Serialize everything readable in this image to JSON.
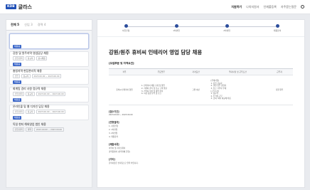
{
  "app": {
    "logo_mark": "KDB",
    "name": "글라스"
  },
  "topnav": {
    "items": [
      {
        "label": "지원하기",
        "active": true
      },
      {
        "label": "나의지원서",
        "active": false
      },
      {
        "label": "인재풀등록",
        "active": false
      },
      {
        "label": "자주묻는질문",
        "active": false
      }
    ]
  },
  "sidebar": {
    "tabs": [
      {
        "label": "전체 5",
        "active": true
      },
      {
        "label": "신입 3",
        "active": false
      },
      {
        "label": "경력 4",
        "active": false
      }
    ],
    "jobs": [
      {
        "badge": "채용중",
        "title": "강원 및 원주지역 영업담당 채용",
        "chips": [
          "신입/경력",
          "정규직",
          "상시채용"
        ]
      },
      {
        "badge": "채용중",
        "title": "충청지역 현장관리직 채용",
        "chips": [
          "신입",
          "정규직",
          "2023.00.00 ~ 2023.00.00"
        ]
      },
      {
        "badge": "채용중",
        "title": "회계팀 경리 사원 정규직 채용",
        "chips": [
          "신입/경력",
          "정규직",
          "2023.00.00 ~ 2023.00.00"
        ]
      },
      {
        "badge": "채용중",
        "title": "온라인몰 및 웹 디자인 담당 채용",
        "chips": [
          "신입/경력",
          "정규직",
          "2023.00.00 ~ 2023.00.00"
        ]
      },
      {
        "badge": "채용중",
        "title": "독일 현지 해외영업 법인 채용",
        "chips": [
          "신입/경력",
          "계약",
          "2023.00.00 ~ 2023.00.00"
        ]
      }
    ]
  },
  "stepper": {
    "steps": [
      "서류전형",
      "1차면접",
      "2차면접",
      "최종합격"
    ]
  },
  "main": {
    "title": "강원/원주 휴비씨 인테리어 영업 담당 채용",
    "section": "[모집부문 및 자격요건]",
    "table": {
      "headers": [
        "직무",
        "주요업무",
        "자격요건",
        "우대사항 및 근무조건",
        "근무지"
      ],
      "row": {
        "c1": "휴비씨 인테리어 영업",
        "c2": "1. 인테리어 제품 소개 및 영업\n2. 거래처 관리 및 신규 고객 발굴\n3. 견적서 작성 및 계약 관리\n4. 시장 동향 분석 및 보고",
        "c3": "고졸 이상",
        "c4": "[우대사항]\n1. 운전 가능자\n2. 관련 업무 경험자\n3. 인근 거주자 우대\n[근무조건]\n1. 정규직\n2. 주 5일 근무\n3. 급여: 회사 내규에 따름",
        "c5": "강원 원주"
      }
    },
    "blocks": [
      {
        "head": "[접수기간]",
        "lines": [
          "2023.00.00 ~ 2023.00.00"
        ]
      },
      {
        "head": "[전형절차]",
        "lines": [
          "1. 서류전형",
          "2. 1차면접",
          "3. 2차면접",
          "4. 최종합격"
        ]
      },
      {
        "head": "[제출서류]",
        "lines": [
          "이력서 및 자기소개서",
          "경력증명서 (경력자에 한함)"
        ]
      },
      {
        "head": "[기타]",
        "lines": [
          "문의사항은 인사팀으로 연락 바랍니다."
        ]
      }
    ]
  }
}
